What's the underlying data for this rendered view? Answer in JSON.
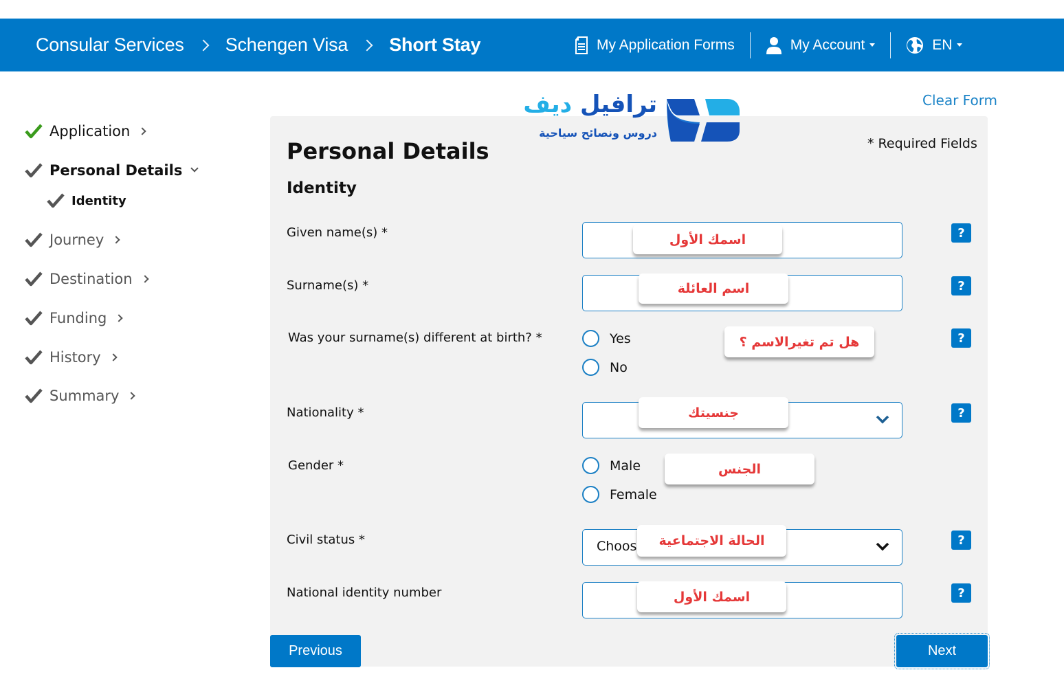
{
  "header": {
    "breadcrumbs": [
      "Consular Services",
      "Schengen Visa",
      "Short Stay"
    ],
    "nav": {
      "forms_label": "My Application Forms",
      "forms_icon": "document-icon",
      "account_label": "My Account",
      "account_icon": "user-icon",
      "language_label": "EN",
      "language_icon": "globe-icon"
    }
  },
  "sidebar": {
    "steps": [
      {
        "label": "Application",
        "status": "complete"
      },
      {
        "label": "Personal Details",
        "status": "active"
      },
      {
        "label": "Journey",
        "status": "complete"
      },
      {
        "label": "Destination",
        "status": "complete"
      },
      {
        "label": "Funding",
        "status": "complete"
      },
      {
        "label": "History",
        "status": "complete"
      },
      {
        "label": "Summary",
        "status": "complete"
      }
    ],
    "substeps": [
      {
        "label": "Identity"
      }
    ]
  },
  "logo": {
    "title_main": "ترافيل",
    "title_accent": "ديف",
    "subtitle": "دروس ونصائح سياحية"
  },
  "clear_form_label": "Clear Form",
  "form": {
    "required_note": "* Required Fields",
    "page_title": "Personal Details",
    "section_title": "Identity",
    "fields": {
      "given_name": {
        "label": "Given name(s) *",
        "value": "",
        "annotation": "اسمك الأول"
      },
      "surname": {
        "label": "Surname(s) *",
        "value": "",
        "annotation": "اسم العائلة"
      },
      "surname_birth": {
        "label": "Was your surname(s) different at birth? *",
        "options": [
          "Yes",
          "No"
        ],
        "annotation": "هل تم تغيرالاسم ؟"
      },
      "nationality": {
        "label": "Nationality *",
        "value": "",
        "annotation": "جنسيتك"
      },
      "gender": {
        "label": "Gender *",
        "options": [
          "Male",
          "Female"
        ],
        "annotation": "الجنس"
      },
      "civil_status": {
        "label": "Civil status *",
        "value": "Choose",
        "annotation": "الحالة الاجتماعية"
      },
      "national_id": {
        "label": "National identity number",
        "value": "",
        "annotation": "اسمك الأول"
      }
    },
    "help_label": "?"
  },
  "buttons": {
    "previous": "Previous",
    "next": "Next"
  },
  "colors": {
    "brand_blue": "#0078c8",
    "check_green": "#3a9b1c",
    "annotation_red": "#e53838",
    "panel_bg": "#f2f2f2"
  }
}
